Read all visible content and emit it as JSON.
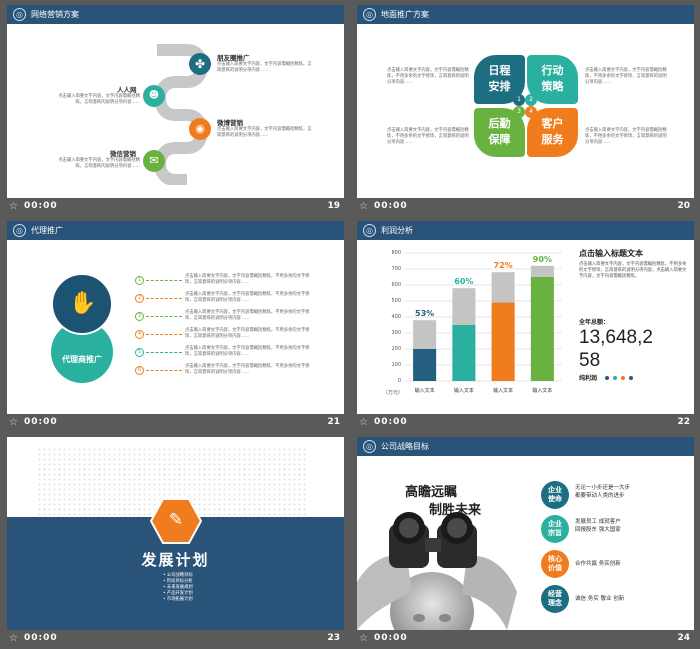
{
  "thumbs": [
    {
      "time": "00:00",
      "num": "19"
    },
    {
      "time": "00:00",
      "num": "20"
    },
    {
      "time": "00:00",
      "num": "21"
    },
    {
      "time": "00:00",
      "num": "22"
    },
    {
      "time": "00:00",
      "num": "23"
    },
    {
      "time": "00:00",
      "num": "24"
    }
  ],
  "s19": {
    "title": "网络营销方案",
    "items": [
      {
        "label": "朋友圈推广",
        "text": "点击输入简要文字内容，文字内容需概括精炼，言简意赅的说明分项内容……"
      },
      {
        "label": "人人网",
        "text": "点击输入简要文字内容，文字内容需概括精炼，言简意赅的说明分项内容……"
      },
      {
        "label": "微博营销",
        "text": "点击输入简要文字内容，文字内容需概括精炼，言简意赅的说明分项内容……"
      },
      {
        "label": "微信营销",
        "text": "点击输入简要文字内容，文字内容需概括精炼，言简意赅的说明分项内容……"
      }
    ]
  },
  "s20": {
    "title": "地面推广方案",
    "petals": [
      {
        "l1": "日程",
        "l2": "安排",
        "n": "1",
        "color": "#1e6e82"
      },
      {
        "l1": "行动",
        "l2": "策略",
        "n": "2",
        "color": "#2ab09e"
      },
      {
        "l1": "后勤",
        "l2": "保障",
        "n": "3",
        "color": "#6ab23f"
      },
      {
        "l1": "客户",
        "l2": "服务",
        "n": "4",
        "color": "#f07c1d"
      }
    ],
    "text": "点击输入简要文字内容，文字内容需概括精炼，不用多余的文字修饰，言简意赅的说明分项内容……"
  },
  "s21": {
    "title": "代理推广",
    "circle_label": "代理商推广",
    "rows": [
      {
        "n": "1",
        "color": "#6ab23f"
      },
      {
        "n": "2",
        "color": "#f07c1d"
      },
      {
        "n": "3",
        "color": "#6ab23f"
      },
      {
        "n": "4",
        "color": "#f07c1d"
      },
      {
        "n": "5",
        "color": "#2ab09e"
      },
      {
        "n": "6",
        "color": "#f07c1d"
      }
    ],
    "row_text": "点击输入简要文字内容，文字内容需概括精炼，不用多余的文字修饰，言简意赅的说明分项内容……"
  },
  "s22": {
    "title": "利润分析",
    "right_title": "点击输入标题文本",
    "right_text": "点击输入简要文字内容，文字内容需概括精炼，不用多余的文字修饰，言简意赅的说明分项内容，点击输入简要文字内容，文字内容需概括精炼。",
    "sub_label": "全年总额：",
    "big_num_1": "13,648,2",
    "big_num_2": "58",
    "unit_label": "纯利润",
    "y_unit": "（万元）"
  },
  "chart_data": {
    "type": "bar",
    "categories": [
      "输入文本",
      "输入文本",
      "输入文本",
      "输入文本"
    ],
    "ylim": [
      0,
      800
    ],
    "yticks": [
      "0",
      "100",
      "200",
      "300",
      "400",
      "500",
      "600",
      "700",
      "800"
    ],
    "series": [
      {
        "values": [
          200,
          350,
          490,
          650
        ]
      },
      {
        "values": [
          380,
          580,
          680,
          720
        ]
      }
    ],
    "percent_labels": [
      "53%",
      "60%",
      "72%",
      "90%"
    ],
    "colors": [
      "#245f80",
      "#2ab09e",
      "#f07c1d",
      "#6ab23f"
    ],
    "ylabel": "（万元）"
  },
  "s23": {
    "title": "发展计划",
    "items": [
      "公司战略目标",
      "阶段目标分析",
      "未来发展规划",
      "产品开发计划",
      "市场拓展计划"
    ]
  },
  "s24": {
    "title": "公司战略目标",
    "head1": "高瞻远瞩",
    "head2": "制胜未来",
    "bullets": [
      {
        "b1": "企业",
        "b2": "使命",
        "text1": "无论一小步还是一大步",
        "text2": "都要带动人类的进步",
        "color": "#1e6e82"
      },
      {
        "b1": "企业",
        "b2": "宗旨",
        "text1": "发展员工  成就客户",
        "text2": "回报股东  强大国家",
        "color": "#2ab09e"
      },
      {
        "b1": "核心",
        "b2": "价值",
        "text1": "合作共赢  务实创新",
        "text2": "",
        "color": "#f07c1d"
      },
      {
        "b1": "经营",
        "b2": "理念",
        "text1": "诚信  务实  敬业  创新",
        "text2": "",
        "color": "#1e6e82"
      }
    ]
  }
}
